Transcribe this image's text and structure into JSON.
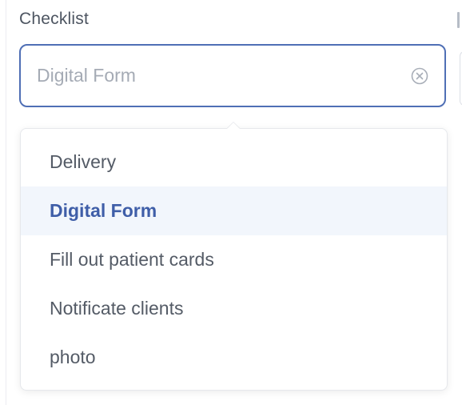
{
  "field": {
    "label": "Checklist",
    "value": "",
    "placeholder": "Digital Form",
    "clear_icon": "circle-x-icon"
  },
  "dropdown": {
    "selected_index": 1,
    "options": [
      {
        "label": "Delivery"
      },
      {
        "label": "Digital Form"
      },
      {
        "label": "Fill out patient cards"
      },
      {
        "label": "Notificate clients"
      },
      {
        "label": "photo"
      }
    ]
  },
  "colors": {
    "accent": "#4f6fb5",
    "selected_text": "#3f5ea8",
    "selected_bg": "#f2f6fc",
    "text": "#545b66",
    "placeholder": "#a5abb5"
  }
}
